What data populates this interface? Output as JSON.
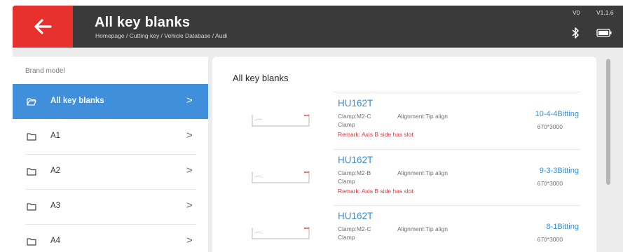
{
  "header": {
    "title": "All key blanks",
    "breadcrumb": "Homepage / Cutting key / Vehicle Database / Audi",
    "version_label": "V0",
    "version_number": "V1.1.6",
    "back_icon": "arrow-left-icon",
    "status_icons": [
      "bluetooth-icon",
      "battery-icon"
    ],
    "back_color": "#e6312c",
    "bar_color": "#3a3a3a"
  },
  "sidebar": {
    "heading": "Brand model",
    "active_color": "#3f8fdb",
    "items": [
      {
        "label": "All key blanks",
        "icon": "folder-open-icon",
        "chevron": ">",
        "active": true
      },
      {
        "label": "A1",
        "icon": "folder-icon",
        "chevron": ">",
        "active": false
      },
      {
        "label": "A2",
        "icon": "folder-icon",
        "chevron": ">",
        "active": false
      },
      {
        "label": "A3",
        "icon": "folder-icon",
        "chevron": ">",
        "active": false
      },
      {
        "label": "A4",
        "icon": "folder-icon",
        "chevron": ">",
        "active": false
      }
    ]
  },
  "content": {
    "title": "All key blanks",
    "accent_color": "#3a8fd6",
    "remark_color": "#e2343a",
    "rows": [
      {
        "model": "HU162T",
        "clamp": "Clamp:M2-C",
        "alignment": "Alignment:Tip align",
        "clamp_note": "Clamp",
        "remark": "Remark: Axis B side has slot",
        "bitting": "10-4-4Bitting",
        "size": "670*3000"
      },
      {
        "model": "HU162T",
        "clamp": "Clamp:M2-B",
        "alignment": "Alignment:Tip align",
        "clamp_note": "Clamp",
        "remark": "Remark: Axis B side has slot",
        "bitting": "9-3-3Bitting",
        "size": "670*3000"
      },
      {
        "model": "HU162T",
        "clamp": "Clamp:M2-C",
        "alignment": "Alignment:Tip align",
        "clamp_note": "Clamp",
        "remark": "",
        "bitting": "8-1Bitting",
        "size": "670*3000"
      }
    ]
  }
}
